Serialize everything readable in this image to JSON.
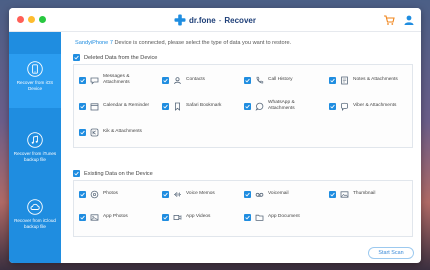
{
  "app": {
    "brand": "dr.fone",
    "separator": "-",
    "module": "Recover"
  },
  "colors": {
    "accent": "#1f8de0",
    "sidebar": "#1f8de0",
    "cart_icon": "#f0841a"
  },
  "sidebar": {
    "items": [
      {
        "label": "Recover from iOS Device",
        "icon": "phone-icon"
      },
      {
        "label": "Recover from iTunes backup file",
        "icon": "music-icon"
      },
      {
        "label": "Recover from iCloud backup file",
        "icon": "cloud-icon"
      }
    ]
  },
  "intro": {
    "device": "SandyiPhone 7",
    "text": " Device is connected, please select the type of data you want to restore."
  },
  "deleted": {
    "heading": "Deleted Data from the Device",
    "items": [
      {
        "label": "Messages & Attachments",
        "icon": "message-icon"
      },
      {
        "label": "Contacts",
        "icon": "contacts-icon"
      },
      {
        "label": "Call History",
        "icon": "phone-call-icon"
      },
      {
        "label": "Notes & Attachments",
        "icon": "notes-icon"
      },
      {
        "label": "Calendar & Reminder",
        "icon": "calendar-icon"
      },
      {
        "label": "Safari Bookmark",
        "icon": "bookmark-icon"
      },
      {
        "label": "WhatsApp & Attachments",
        "icon": "whatsapp-icon"
      },
      {
        "label": "Viber & Attachments",
        "icon": "viber-icon"
      },
      {
        "label": "Kik & Attachments",
        "icon": "kik-icon"
      }
    ]
  },
  "existing": {
    "heading": "Existing Data on the Device",
    "items": [
      {
        "label": "Photos",
        "icon": "photos-icon"
      },
      {
        "label": "Voice Memos",
        "icon": "voice-memo-icon"
      },
      {
        "label": "Voicemail",
        "icon": "voicemail-icon"
      },
      {
        "label": "Thumbnail",
        "icon": "thumbnail-icon"
      },
      {
        "label": "App Photos",
        "icon": "app-photos-icon"
      },
      {
        "label": "App Videos",
        "icon": "app-videos-icon"
      },
      {
        "label": "App Document",
        "icon": "app-document-icon"
      }
    ]
  },
  "actions": {
    "start_scan": "Start Scan"
  }
}
